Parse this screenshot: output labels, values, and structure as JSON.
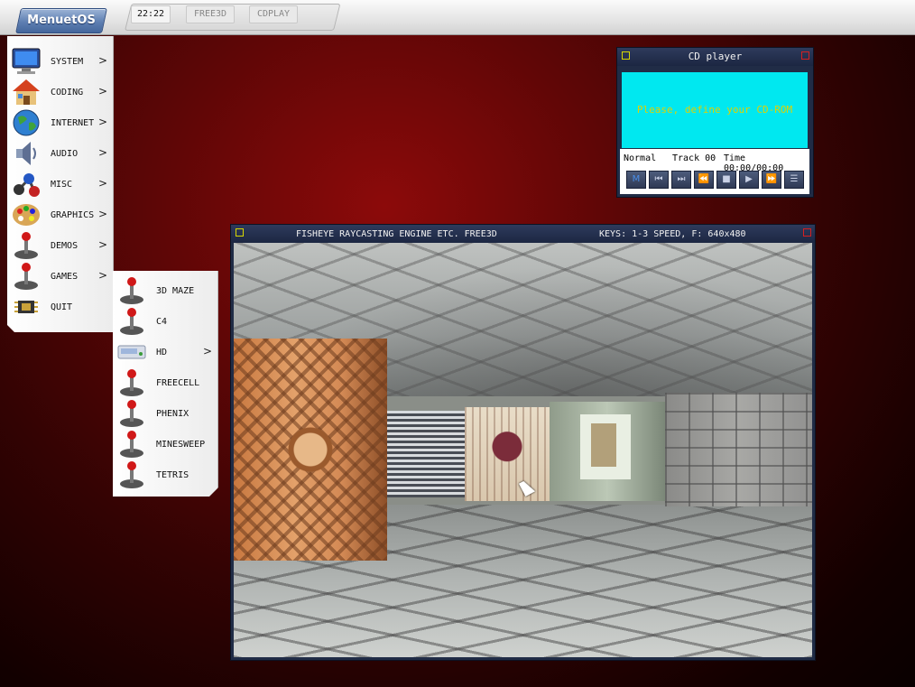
{
  "taskbar": {
    "menu_button": "MenuetOS",
    "clock": "22:22",
    "tasks": [
      "FREE3D",
      "CDPLAY"
    ]
  },
  "main_menu": {
    "items": [
      {
        "label": "SYSTEM",
        "icon": "monitor-icon",
        "submenu": true
      },
      {
        "label": "CODING",
        "icon": "house-icon",
        "submenu": true
      },
      {
        "label": "INTERNET",
        "icon": "globe-icon",
        "submenu": true
      },
      {
        "label": "AUDIO",
        "icon": "speaker-icon",
        "submenu": true
      },
      {
        "label": "MISC",
        "icon": "molecule-icon",
        "submenu": true
      },
      {
        "label": "GRAPHICS",
        "icon": "palette-icon",
        "submenu": true
      },
      {
        "label": "DEMOS",
        "icon": "joystick-icon",
        "submenu": true
      },
      {
        "label": "GAMES",
        "icon": "joystick-icon",
        "submenu": true
      },
      {
        "label": "QUIT",
        "icon": "chip-icon",
        "submenu": false
      }
    ]
  },
  "games_menu": {
    "items": [
      {
        "label": "3D MAZE",
        "icon": "joystick-icon",
        "submenu": false
      },
      {
        "label": "C4",
        "icon": "joystick-icon",
        "submenu": false
      },
      {
        "label": "HD",
        "icon": "hard-drive-icon",
        "submenu": true
      },
      {
        "label": "FREECELL",
        "icon": "joystick-icon",
        "submenu": false
      },
      {
        "label": "PHENIX",
        "icon": "joystick-icon",
        "submenu": false
      },
      {
        "label": "MINESWEEP",
        "icon": "joystick-icon",
        "submenu": false
      },
      {
        "label": "TETRIS",
        "icon": "joystick-icon",
        "submenu": false
      }
    ]
  },
  "submenu_arrow": ">",
  "cd_player": {
    "title": "CD player",
    "message": "Please, define your CD-ROM",
    "mode": "Normal",
    "track": "Track 00",
    "time": "Time 00:00/00:00",
    "buttons": [
      "M",
      "⏮",
      "⏭",
      "⏪",
      "■",
      "▶",
      "⏩",
      "☰"
    ],
    "colors": {
      "screen": "#00e8f0",
      "message": "#e0d200"
    }
  },
  "free3d": {
    "title": "FISHEYE RAYCASTING ENGINE ETC. FREE3D",
    "keys": "KEYS: 1-3 SPEED, F: 640x480"
  }
}
